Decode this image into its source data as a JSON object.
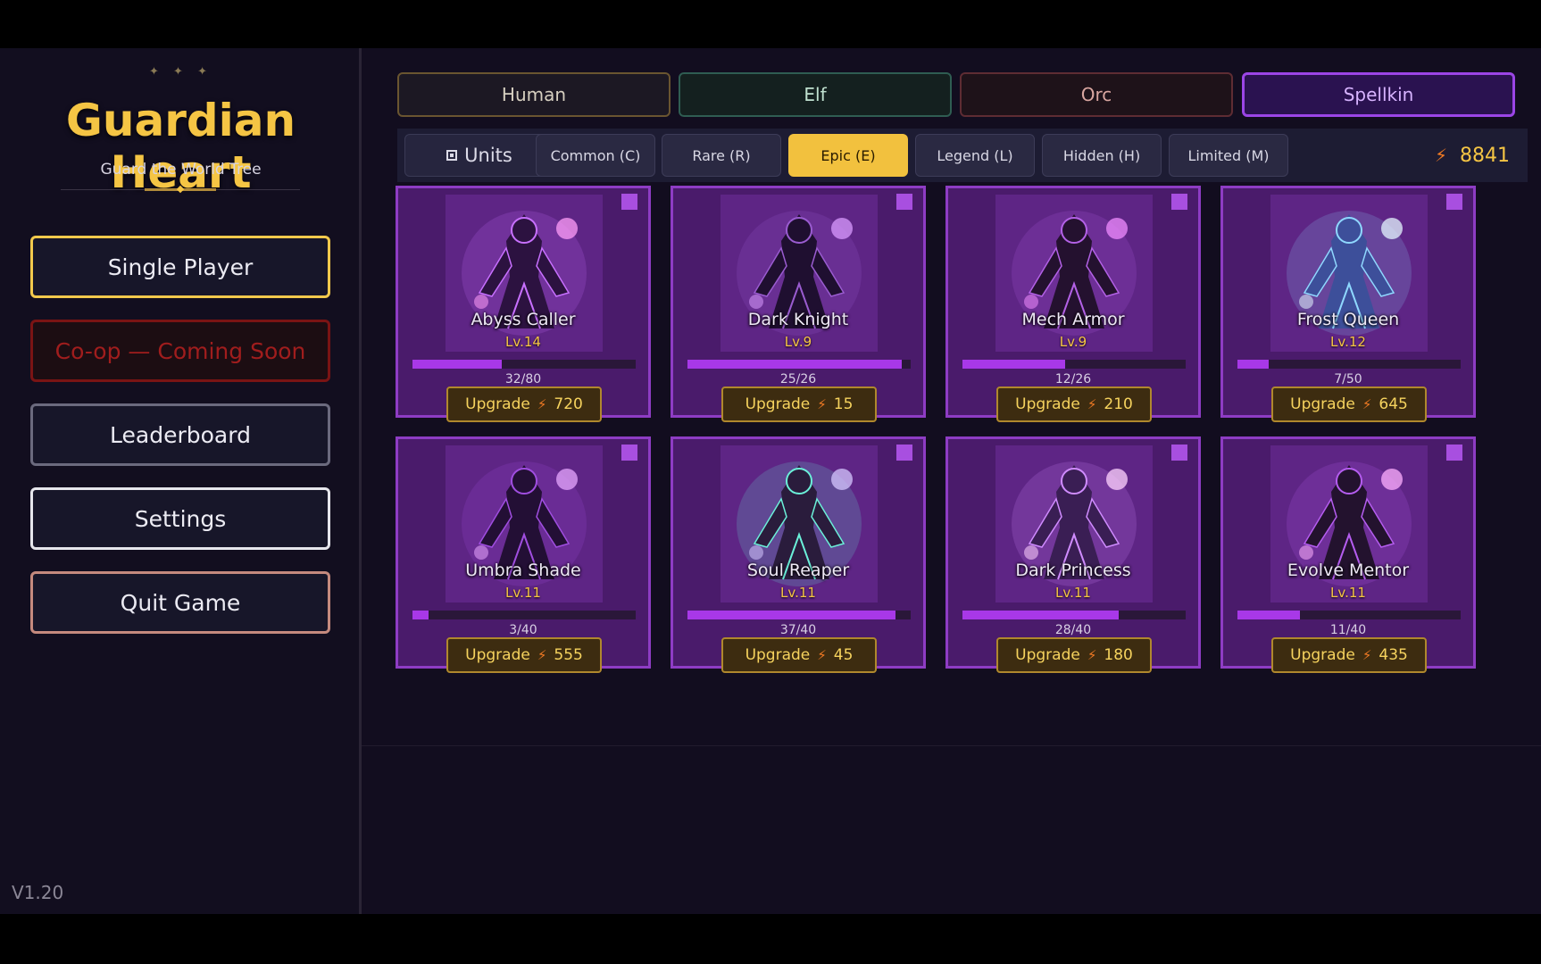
{
  "sidebar": {
    "stars": "✦ ✦ ✦",
    "title": "Guardian Heart",
    "subtitle": "Guard the World Tree",
    "menu": {
      "single_player": "Single Player",
      "coop": "Co-op — Coming Soon",
      "leaderboard": "Leaderboard",
      "settings": "Settings",
      "quit": "Quit Game"
    },
    "version": "V1.20"
  },
  "factions": {
    "human": "Human",
    "elf": "Elf",
    "orc": "Orc",
    "spellkin": "Spellkin",
    "active": "Spellkin"
  },
  "rarity": {
    "units_label": "Units",
    "tabs": [
      "Common (C)",
      "Rare (R)",
      "Epic (E)",
      "Legend (L)",
      "Hidden (H)",
      "Limited (M)"
    ],
    "active": "Epic (E)"
  },
  "currency": {
    "icon": "lightning-icon",
    "amount": "8841"
  },
  "upgrade_label": "Upgrade",
  "units": [
    {
      "name": "Abyss Caller",
      "level": "Lv.14",
      "xp": "32/80",
      "progress": 0.4,
      "cost": "720"
    },
    {
      "name": "Dark Knight",
      "level": "Lv.9",
      "xp": "25/26",
      "progress": 0.96,
      "cost": "15"
    },
    {
      "name": "Mech Armor",
      "level": "Lv.9",
      "xp": "12/26",
      "progress": 0.46,
      "cost": "210"
    },
    {
      "name": "Frost Queen",
      "level": "Lv.12",
      "xp": "7/50",
      "progress": 0.14,
      "cost": "645"
    },
    {
      "name": "Umbra Shade",
      "level": "Lv.11",
      "xp": "3/40",
      "progress": 0.07,
      "cost": "555"
    },
    {
      "name": "Soul Reaper",
      "level": "Lv.11",
      "xp": "37/40",
      "progress": 0.93,
      "cost": "45"
    },
    {
      "name": "Dark Princess",
      "level": "Lv.11",
      "xp": "28/40",
      "progress": 0.7,
      "cost": "180"
    },
    {
      "name": "Evolve Mentor",
      "level": "Lv.11",
      "xp": "11/40",
      "progress": 0.28,
      "cost": "435"
    }
  ],
  "colors": {
    "accent_gold": "#f2c13e",
    "spellkin_purple": "#9b45e6",
    "card_bg": "#4a1b6b",
    "xp_bar": "#a838e8",
    "coop_red": "#a01d1d"
  }
}
